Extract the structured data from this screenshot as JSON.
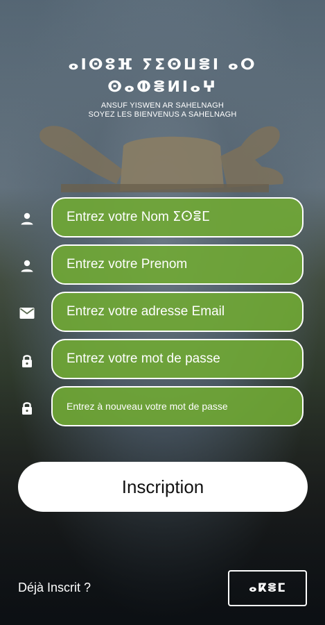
{
  "header": {
    "tifinagh_line1": "ⴰⵏⵙⵓⴼ ⵢⵉⵙⵡⴻⵏ ⴰⵔ",
    "tifinagh_line2": "ⵙⴰⵀⴻⵍⵏⴰⵖ",
    "line_kabyle": "ANSUF YISWEN AR SAHELNAGH",
    "line_french": "SOYEZ LES BIENVENUS A SAHELNAGH"
  },
  "form": {
    "nom_placeholder": "Entrez votre Nom ⵉⵙⴻⵎ",
    "prenom_placeholder": "Entrez votre Prenom",
    "email_placeholder": "Entrez votre adresse Email",
    "password_placeholder": "Entrez votre mot de passe",
    "password_confirm_placeholder": "Entrez à nouveau votre mot de passe"
  },
  "actions": {
    "register_label": "Inscription",
    "already_registered": "Déjà Inscrit ?",
    "login_label": "ⴰⴽⴻⵎ"
  },
  "icons": {
    "nom": "person-icon",
    "prenom": "person-icon",
    "email": "mail-icon",
    "password": "lock-icon",
    "password_confirm": "lock-icon"
  },
  "colors": {
    "field_green": "#70a834",
    "button_bg": "#ffffff",
    "button_text": "#111111"
  }
}
